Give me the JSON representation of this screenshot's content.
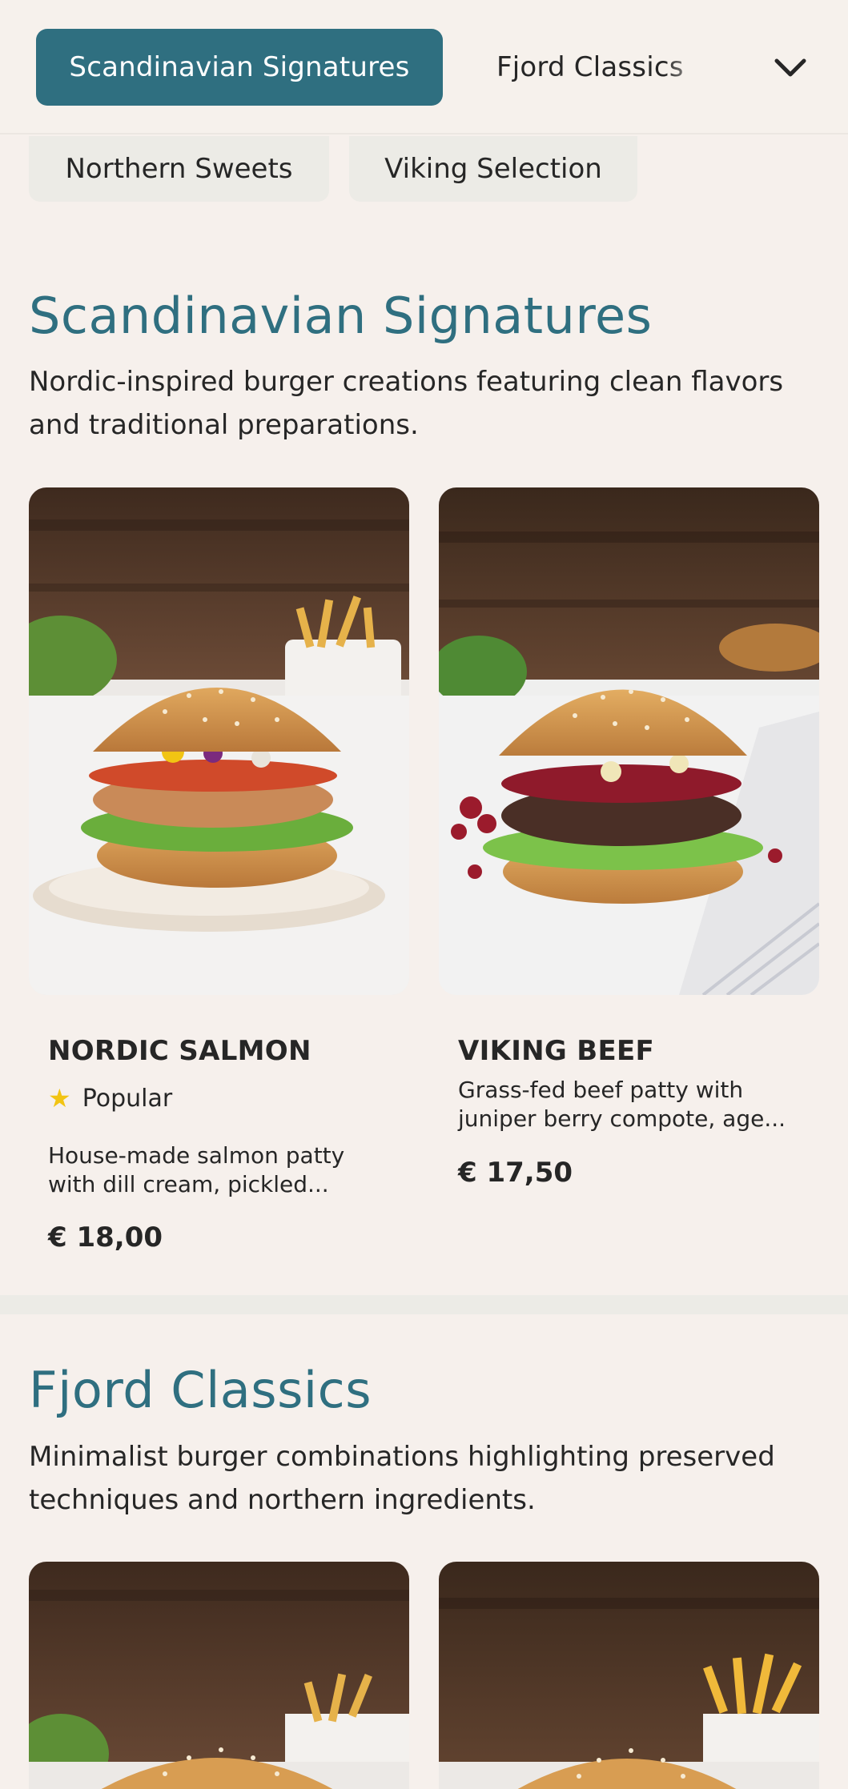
{
  "nav": {
    "active_tab": "Scandinavian Signatures",
    "next_tab": "Fjord Classics",
    "expand_icon": "chevron-down-icon",
    "chips": [
      "Northern Sweets",
      "Viking Selection"
    ],
    "accent_color": "#2f6f80"
  },
  "sections": [
    {
      "title": "Scandinavian Signatures",
      "description": "Nordic-inspired burger creations featuring clean flavors and traditional preparations.",
      "items": [
        {
          "name": "NORDIC SALMON",
          "badge": "Popular",
          "description_line1": "House-made salmon patty",
          "description_line2": "with dill cream, pickled...",
          "price": "€ 18,00"
        },
        {
          "name": "VIKING BEEF",
          "description_line1": "Grass-fed beef patty with",
          "description_line2": "juniper berry compote, age...",
          "price": "€ 17,50"
        }
      ]
    },
    {
      "title": "Fjord Classics",
      "description": "Minimalist burger combinations highlighting preserved techniques and northern ingredients."
    }
  ]
}
